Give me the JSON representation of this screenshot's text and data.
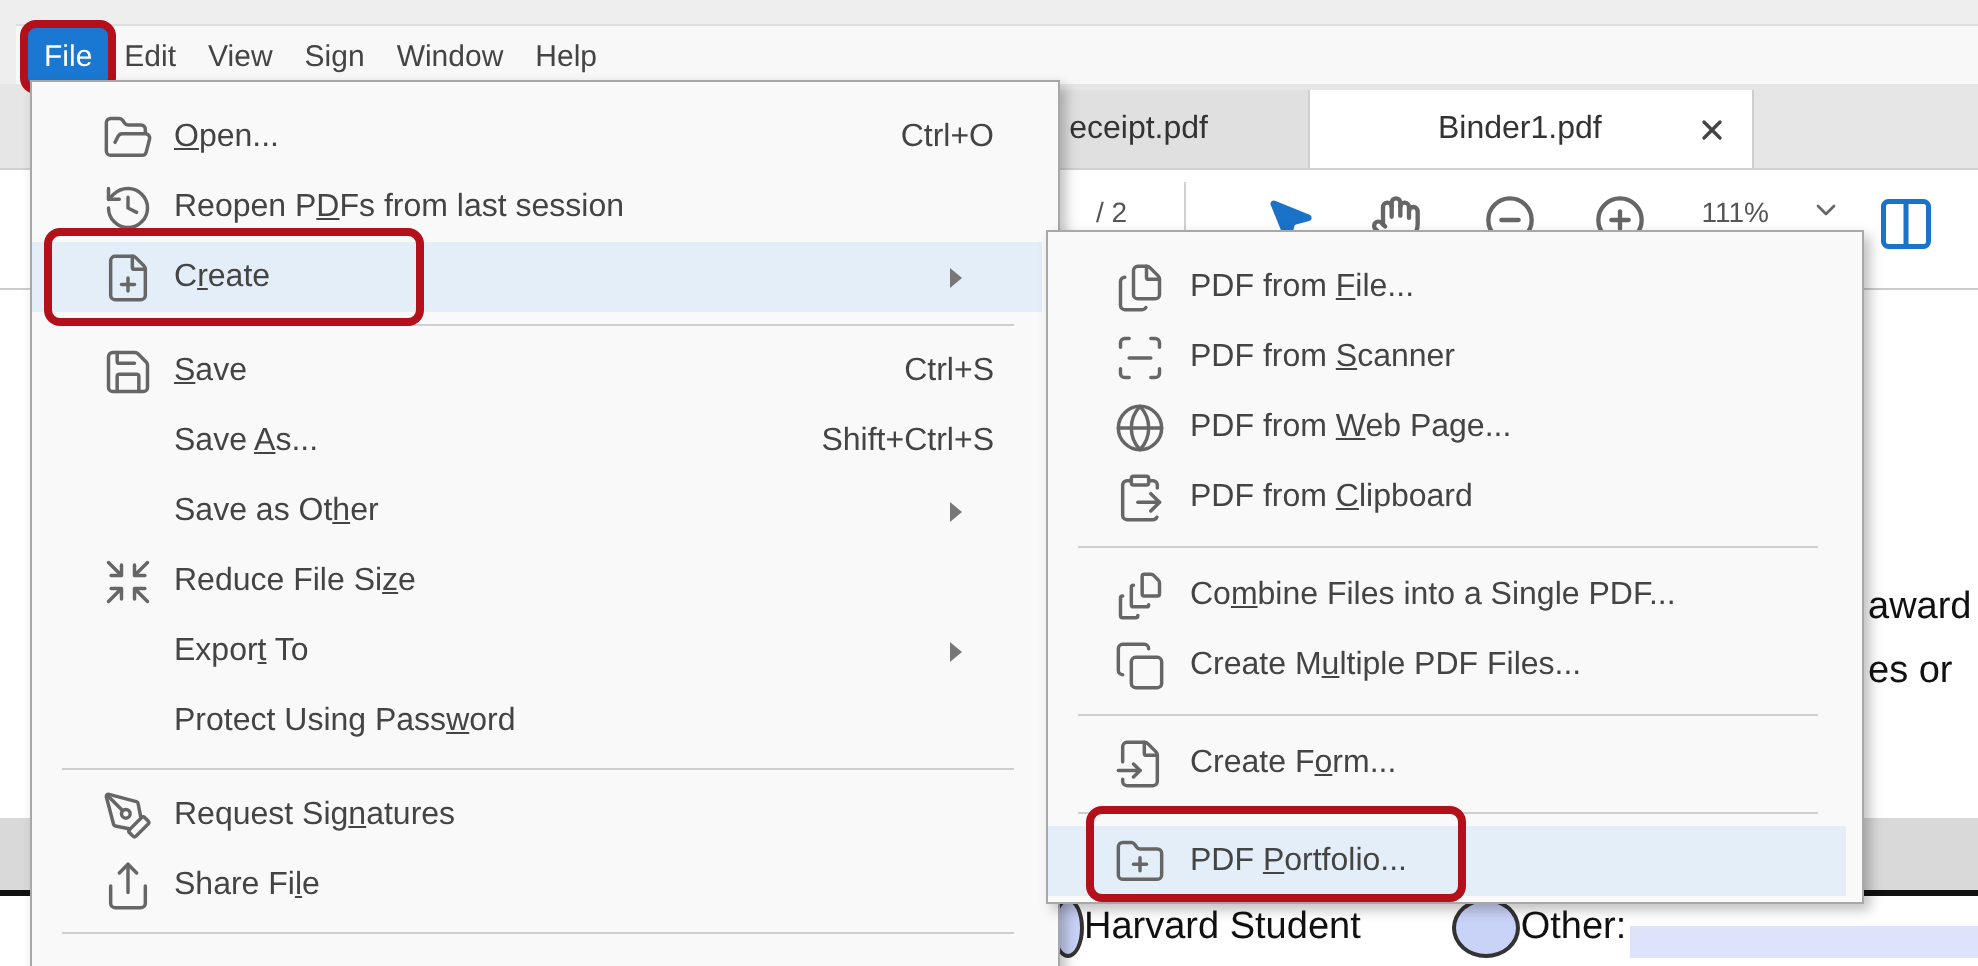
{
  "menu_bar": [
    {
      "label": "File",
      "selected": true,
      "annotated": true
    },
    {
      "label": "Edit",
      "selected": false,
      "annotated": false
    },
    {
      "label": "View",
      "selected": false,
      "annotated": false
    },
    {
      "label": "Sign",
      "selected": false,
      "annotated": false
    },
    {
      "label": "Window",
      "selected": false,
      "annotated": false
    },
    {
      "label": "Help",
      "selected": false,
      "annotated": false
    }
  ],
  "tabs": [
    {
      "label": "eceipt.pdf",
      "selected": false,
      "closable": false
    },
    {
      "label": "Binder1.pdf",
      "selected": true,
      "closable": true
    }
  ],
  "toolbar": {
    "page_count": "/ 2",
    "zoom": "111%"
  },
  "document": {
    "text_lines": [
      "award",
      "es or"
    ],
    "radio_options": [
      {
        "label": "Harvard Student",
        "selected": false
      },
      {
        "label": "Other:",
        "selected": false
      }
    ]
  },
  "file_menu": [
    {
      "kind": "item",
      "key": "O",
      "after": "pen...",
      "shortcut": "Ctrl+O",
      "has_submenu": false,
      "selected": false,
      "annotated": false
    },
    {
      "kind": "item",
      "before": "Reopen P",
      "key": "D",
      "after": "Fs from last session",
      "has_submenu": false,
      "selected": false,
      "annotated": false
    },
    {
      "kind": "item",
      "before": "C",
      "key": "r",
      "after": "eate",
      "has_submenu": true,
      "selected": true,
      "annotated": true
    },
    {
      "kind": "separator"
    },
    {
      "kind": "item",
      "key": "S",
      "after": "ave",
      "shortcut": "Ctrl+S",
      "has_submenu": false,
      "selected": false,
      "annotated": false
    },
    {
      "kind": "item",
      "before": "Save ",
      "key": "A",
      "after": "s...",
      "shortcut": "Shift+Ctrl+S",
      "has_submenu": false,
      "selected": false,
      "annotated": false
    },
    {
      "kind": "item",
      "before": "Save as Ot",
      "key": "h",
      "after": "er",
      "has_submenu": true,
      "selected": false,
      "annotated": false
    },
    {
      "kind": "item",
      "before": "Reduce File Si",
      "key": "z",
      "after": "e",
      "has_submenu": false,
      "selected": false,
      "annotated": false
    },
    {
      "kind": "item",
      "before": "Expor",
      "key": "t",
      "after": " To",
      "has_submenu": true,
      "selected": false,
      "annotated": false
    },
    {
      "kind": "item",
      "before": "Protect Using Pass",
      "key": "w",
      "after": "ord",
      "has_submenu": false,
      "selected": false,
      "annotated": false
    },
    {
      "kind": "separator"
    },
    {
      "kind": "item",
      "before": "Request Sig",
      "key": "n",
      "after": "atures",
      "has_submenu": false,
      "selected": false,
      "annotated": false
    },
    {
      "kind": "item",
      "before": "Share Fi",
      "key": "l",
      "after": "e",
      "has_submenu": false,
      "selected": false,
      "annotated": false
    },
    {
      "kind": "separator"
    }
  ],
  "create_submenu": [
    {
      "kind": "item",
      "before": "PDF from ",
      "key": "F",
      "after": "ile...",
      "has_submenu": false,
      "selected": false,
      "annotated": false
    },
    {
      "kind": "item",
      "before": "PDF from ",
      "key": "S",
      "after": "canner",
      "has_submenu": false,
      "selected": false,
      "annotated": false
    },
    {
      "kind": "item",
      "before": "PDF from ",
      "key": "W",
      "after": "eb Page...",
      "has_submenu": false,
      "selected": false,
      "annotated": false
    },
    {
      "kind": "item",
      "before": "PDF from ",
      "key": "C",
      "after": "lipboard",
      "has_submenu": false,
      "selected": false,
      "annotated": false
    },
    {
      "kind": "separator"
    },
    {
      "kind": "item",
      "before": "Co",
      "key": "m",
      "after": "bine Files into a Single PDF...",
      "has_submenu": false,
      "selected": false,
      "annotated": false
    },
    {
      "kind": "item",
      "before": "Create M",
      "key": "u",
      "after": "ltiple PDF Files...",
      "has_submenu": false,
      "selected": false,
      "annotated": false
    },
    {
      "kind": "separator"
    },
    {
      "kind": "item",
      "before": "Create F",
      "key": "o",
      "after": "rm...",
      "has_submenu": false,
      "selected": false,
      "annotated": false
    },
    {
      "kind": "separator"
    },
    {
      "kind": "item",
      "before": "PDF ",
      "key": "P",
      "after": "ortfolio...",
      "has_submenu": false,
      "selected": true,
      "annotated": true
    }
  ]
}
